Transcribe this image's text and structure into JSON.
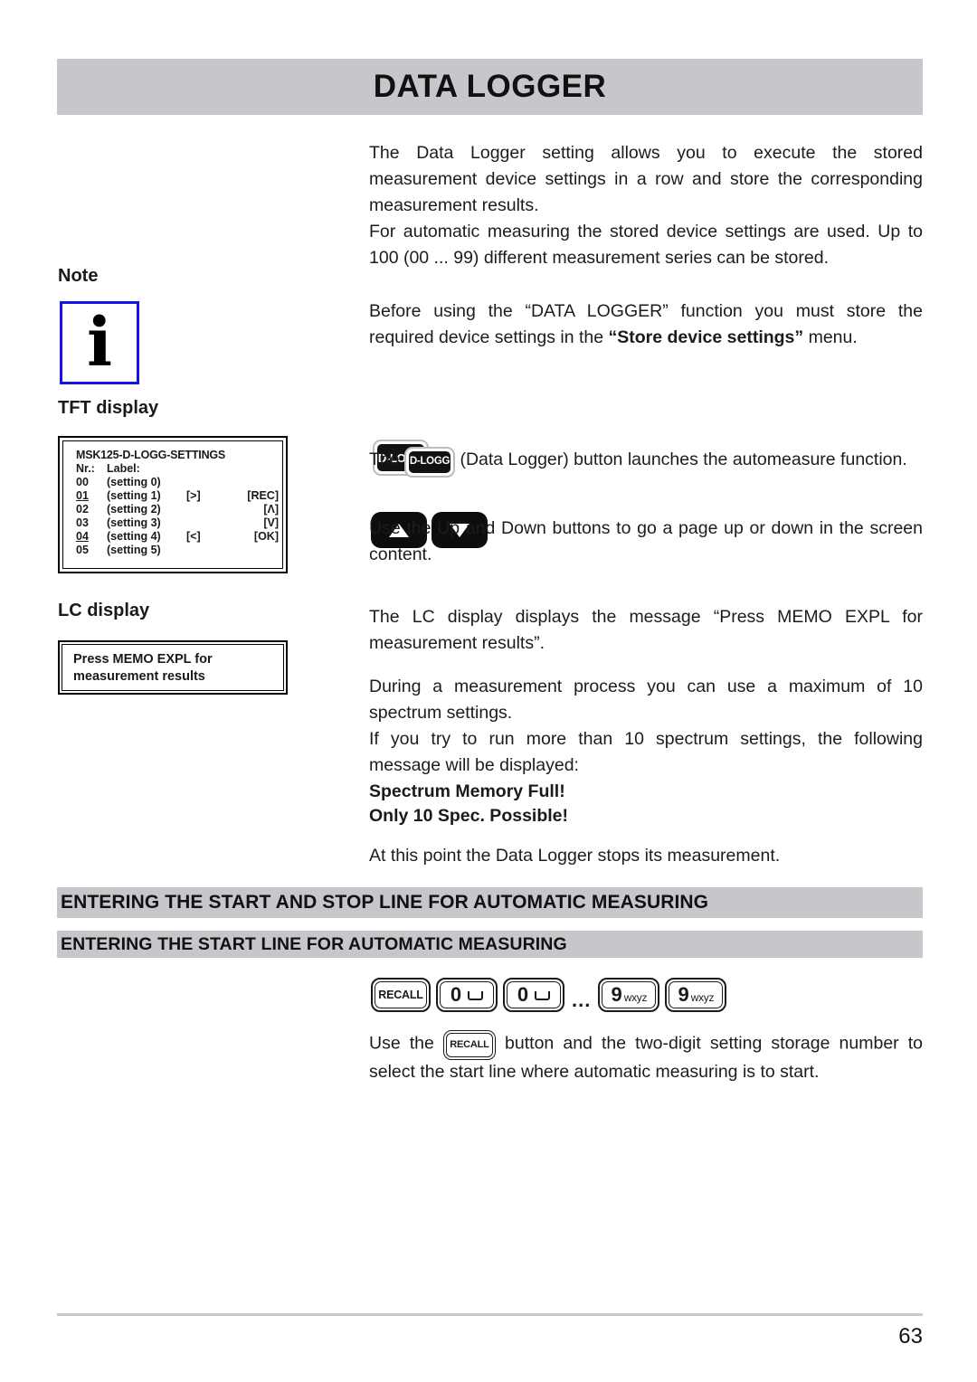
{
  "header": {
    "title": "DATA LOGGER"
  },
  "intro": {
    "para1": "The Data Logger setting allows you to execute the stored measurement device settings in a row and store the corresponding measurement results.",
    "para2": "For automatic measuring the stored device settings are used. Up to 100 (00 ... 99) different measurement series can be stored."
  },
  "note": {
    "label": "Note",
    "icon_glyph": "i",
    "icon_name": "info-icon",
    "icon_border_color": "#1414E6",
    "text_before": "Before using the “DATA LOGGER” function you must store the required device settings in the ",
    "text_bold": "“Store device settings”",
    "text_after": " menu."
  },
  "tft": {
    "label": "TFT display",
    "title": "MSK125-D-LOGG-SETTINGS",
    "header_nr": "Nr.:",
    "header_label": "Label:",
    "rows": [
      {
        "nr": "00",
        "label": "(setting 0)",
        "nav": "",
        "key": "",
        "underline": false
      },
      {
        "nr": "01",
        "label": "(setting 1)",
        "nav": "[>]",
        "key": "[REC]",
        "underline": true
      },
      {
        "nr": "02",
        "label": "(setting 2)",
        "nav": "",
        "key": "[Λ]",
        "underline": false
      },
      {
        "nr": "03",
        "label": "(setting 3)",
        "nav": "",
        "key": "[V]",
        "underline": false
      },
      {
        "nr": "04",
        "label": "(setting 4)",
        "nav": "[<]",
        "key": "[OK]",
        "underline": true
      },
      {
        "nr": "05",
        "label": "(setting 5)",
        "nav": "",
        "key": "",
        "underline": false
      }
    ]
  },
  "lcd": {
    "label": "LC display",
    "line1": "Press MEMO EXPL for",
    "line2": "measurement results"
  },
  "buttons": {
    "dlogg_label": "D-LOGG",
    "dlogg_name": "d-logg-button",
    "up_name": "up-arrow-button",
    "down_name": "down-arrow-button",
    "recall_label": "RECALL",
    "keys": [
      {
        "digit": "0",
        "sub": "",
        "space": true
      },
      {
        "digit": "0",
        "sub": "",
        "space": true
      },
      {
        "digit": "9",
        "sub": "wxyz",
        "space": false
      },
      {
        "digit": "9",
        "sub": "wxyz",
        "space": false
      }
    ],
    "ellipsis": "..."
  },
  "dlogg_para": {
    "before": "The ",
    "after": " (Data Logger) button launches the automeasure function."
  },
  "updown_para": {
    "text": "Use the Up and Down buttons to go a page up or down in the screen content."
  },
  "lcd_para": {
    "text": "The LC display displays the message “Press MEMO EXPL for measurement results”."
  },
  "during_para": {
    "para1": "During a measurement process you can use a maximum of 10 spectrum settings.",
    "para2": "If you try to run more than 10 spectrum settings, the following message will be displayed:"
  },
  "memory_full": {
    "line1": "Spectrum Memory Full!",
    "line2": "Only 10 Spec. Possible!"
  },
  "stop_para": {
    "text": "At this point the Data Logger stops its measurement."
  },
  "sections": {
    "section1": "ENTERING THE START AND STOP LINE FOR AUTOMATIC MEASURING",
    "section2": "ENTERING THE START LINE FOR AUTOMATIC MEASURING"
  },
  "recall_para": {
    "before": "Use the ",
    "after": " button and the two-digit setting storage number to select the start line where automatic measuring is to start."
  },
  "footer": {
    "page_number": "63"
  },
  "colors": {
    "bar_gray": "#C6C7CA",
    "note_blue": "#1414E6",
    "key_black": "#121212"
  }
}
